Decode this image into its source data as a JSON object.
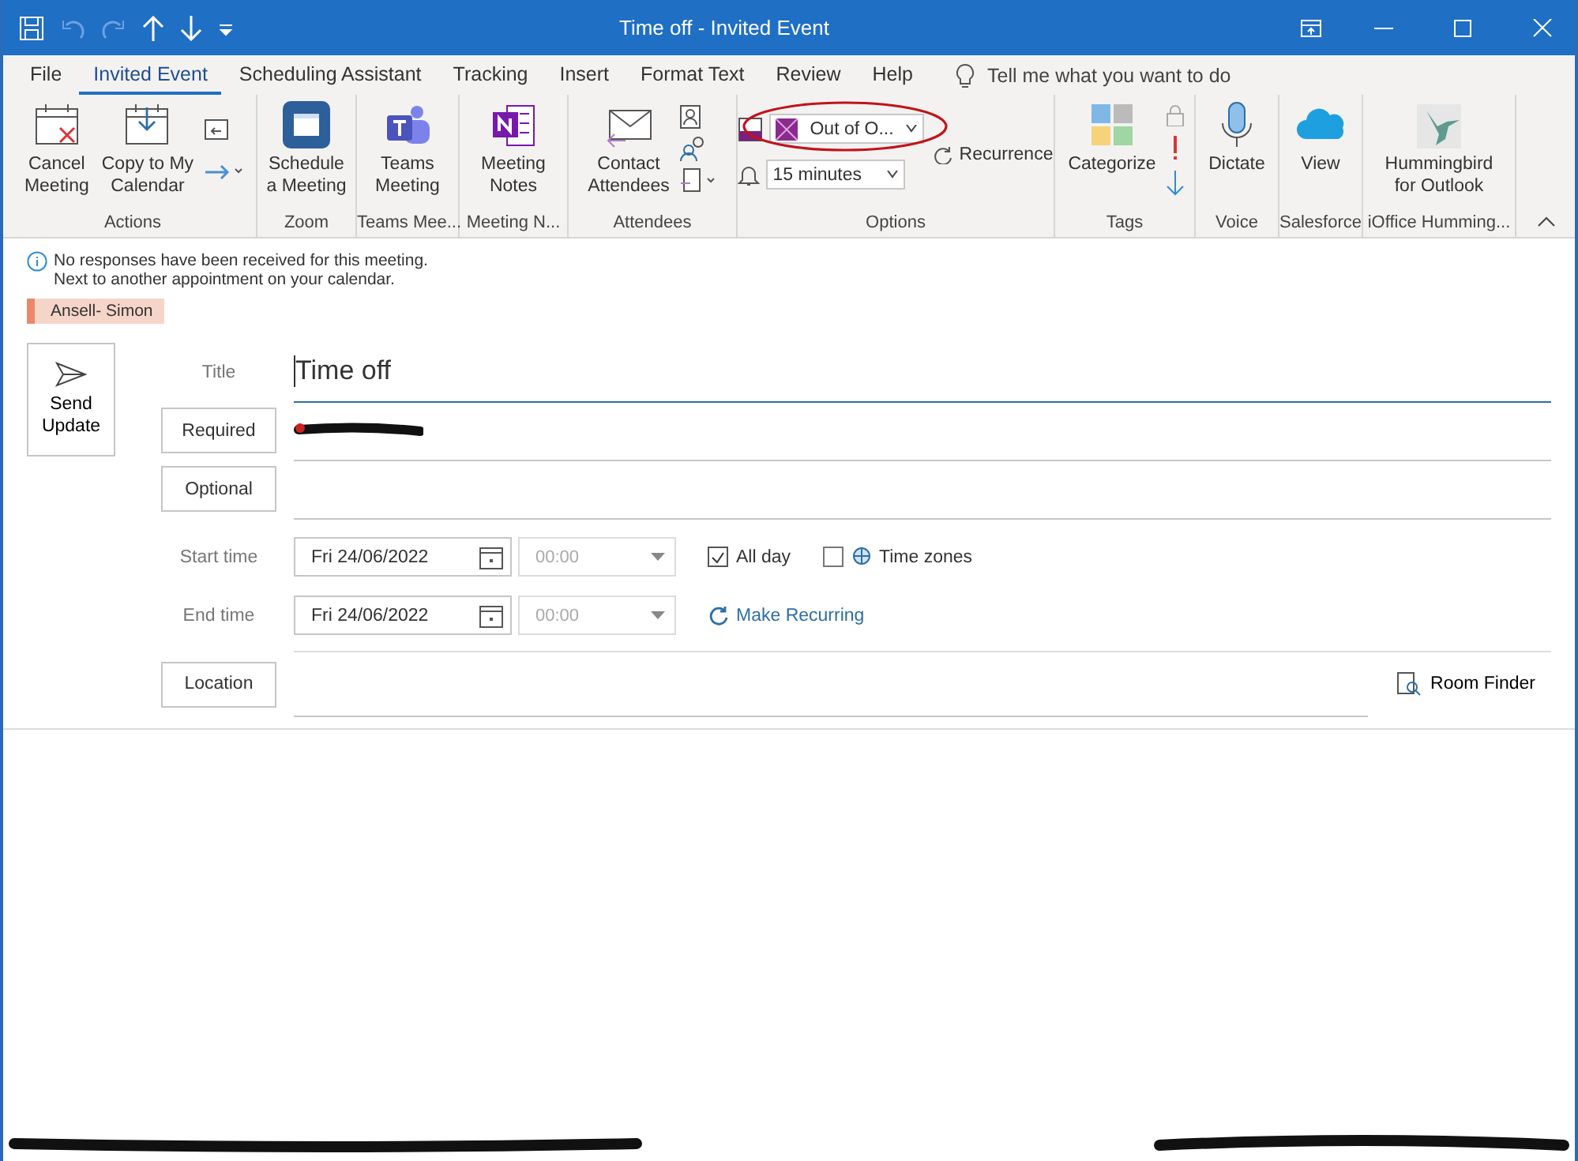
{
  "window": {
    "title": "Time off  -  Invited Event"
  },
  "tabs": [
    {
      "label": "File",
      "selected": false
    },
    {
      "label": "Invited Event",
      "selected": true
    },
    {
      "label": "Scheduling Assistant",
      "selected": false
    },
    {
      "label": "Tracking",
      "selected": false
    },
    {
      "label": "Insert",
      "selected": false
    },
    {
      "label": "Format Text",
      "selected": false
    },
    {
      "label": "Review",
      "selected": false
    },
    {
      "label": "Help",
      "selected": false
    }
  ],
  "tell_me": {
    "placeholder": "Tell me what you want to do"
  },
  "ribbon_groups": [
    {
      "label": "Actions",
      "buttons": [
        {
          "lines": [
            "Cancel",
            "Meeting"
          ]
        },
        {
          "lines": [
            "Copy to My",
            "Calendar"
          ]
        }
      ]
    },
    {
      "label": "Zoom",
      "buttons": [
        {
          "lines": [
            "Schedule",
            "a Meeting"
          ]
        }
      ]
    },
    {
      "label": "Teams Mee...",
      "buttons": [
        {
          "lines": [
            "Teams",
            "Meeting"
          ]
        }
      ]
    },
    {
      "label": "Meeting N...",
      "buttons": [
        {
          "lines": [
            "Meeting",
            "Notes"
          ]
        }
      ]
    },
    {
      "label": "Attendees",
      "buttons": [
        {
          "lines": [
            "Contact",
            "Attendees"
          ]
        }
      ]
    },
    {
      "label": "Options"
    },
    {
      "label": "Tags",
      "buttons": [
        {
          "lines": [
            "Categorize"
          ]
        }
      ]
    },
    {
      "label": "Voice",
      "buttons": [
        {
          "lines": [
            "Dictate"
          ]
        }
      ]
    },
    {
      "label": "Salesforce",
      "buttons": [
        {
          "lines": [
            "View"
          ]
        }
      ]
    },
    {
      "label": "iOffice Humming...",
      "buttons": [
        {
          "lines": [
            "Hummingbird",
            "for Outlook"
          ]
        }
      ]
    }
  ],
  "options": {
    "show_as": {
      "value": "Out of O..."
    },
    "reminder": {
      "value": "15 minutes"
    },
    "recurrence": "Recurrence"
  },
  "info": {
    "messages": [
      "No responses have been received for this meeting.",
      "Next to another appointment on your calendar."
    ],
    "attendee_tag": {
      "label": "Ansell- Simon",
      "color": "#e8896a"
    }
  },
  "send": {
    "lines": [
      "Send",
      "Update"
    ]
  },
  "form": {
    "title_label": "Title",
    "title_value": "Time off",
    "required": "Required",
    "optional": "Optional",
    "start": {
      "label": "Start time",
      "date": "Fri 24/06/2022",
      "time": "00:00",
      "disabled": true
    },
    "end": {
      "label": "End time",
      "date": "Fri 24/06/2022",
      "time": "00:00",
      "disabled": true
    },
    "all_day": {
      "label": "All day",
      "checked": true
    },
    "time_zones": {
      "label": "Time zones",
      "checked": false
    },
    "make_recurring": "Make Recurring",
    "location": "Location",
    "room_finder": "Room Finder"
  }
}
